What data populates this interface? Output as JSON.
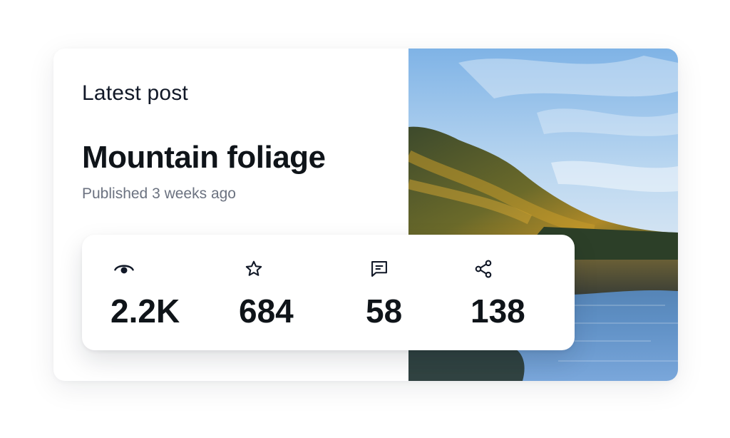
{
  "card": {
    "label": "Latest post",
    "title": "Mountain foliage",
    "subtitle": "Published 3 weeks ago"
  },
  "stats": [
    {
      "icon": "eye-icon",
      "value": "2.2K"
    },
    {
      "icon": "star-icon",
      "value": "684"
    },
    {
      "icon": "comment-icon",
      "value": "58"
    },
    {
      "icon": "share-icon",
      "value": "138"
    }
  ],
  "colors": {
    "text_primary": "#0f1419",
    "text_secondary": "#6b7280",
    "card_bg": "#ffffff"
  }
}
